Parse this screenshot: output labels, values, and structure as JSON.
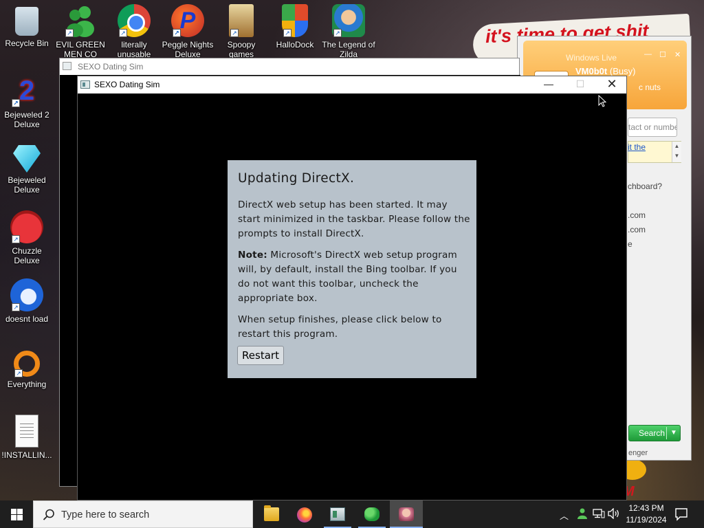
{
  "desktop": {
    "icons": [
      {
        "label": "Recycle Bin",
        "icon": "recycle-bin-icon"
      },
      {
        "label": "EVIL GREEN MEN CO",
        "icon": "evil-green-men-icon"
      },
      {
        "label": "literally unusable",
        "icon": "chrome-icon"
      },
      {
        "label": "Peggle Nights Deluxe",
        "icon": "peggle-icon"
      },
      {
        "label": "Spoopy games",
        "icon": "spoopy-games-icon"
      },
      {
        "label": "HalloDock",
        "icon": "hallodock-shield-icon"
      },
      {
        "label": "The Legend of Zilda",
        "icon": "zilda-icon"
      },
      {
        "label": "Bejeweled 2 Deluxe",
        "icon": "bejeweled-2-icon"
      },
      {
        "label": "Bejeweled Deluxe",
        "icon": "bejeweled-diamond-icon"
      },
      {
        "label": "Chuzzle Deluxe",
        "icon": "chuzzle-icon"
      },
      {
        "label": "doesnt load",
        "icon": "thunderbird-icon"
      },
      {
        "label": "Everything",
        "icon": "everything-search-icon"
      },
      {
        "label": "!INSTALLIN...",
        "icon": "text-document-icon"
      }
    ],
    "wallpaper_text": "it's time to get shit"
  },
  "background_window": {
    "title": "SEXO Dating Sim"
  },
  "window": {
    "title": "SEXO Dating Sim",
    "controls": {
      "minimize": "—",
      "maximize": "☐",
      "close": "✕"
    }
  },
  "dialog": {
    "heading": "Updating DirectX.",
    "paragraph1": "DirectX web setup has been started. It may start minimized in the taskbar. Please follow the prompts to install DirectX.",
    "note_label": "Note:",
    "paragraph2": " Microsoft's DirectX web setup program will, by default, install the Bing toolbar. If you do not want this toolbar, uncheck the appropriate box.",
    "paragraph3": "When setup finishes, please click below to restart this program.",
    "button_label": "Restart"
  },
  "messenger": {
    "title": "Windows Live",
    "username": "VM0b0t",
    "status": "(Busy)",
    "personal_message": "c nuts",
    "search_placeholder": "tact or numbe",
    "link_text": "it the",
    "list_items": [
      "chboard?",
      ".com",
      ".com",
      "e"
    ],
    "search_button": "Search",
    "footer": "enger"
  },
  "taskbar": {
    "search_placeholder": "Type here to search",
    "apps": [
      "file-explorer",
      "firefox",
      "sexo-dating-sim-window",
      "windows-live-messenger",
      "sexo-dating-sim-game"
    ],
    "time": "12:43 PM",
    "date": "11/19/2024"
  }
}
